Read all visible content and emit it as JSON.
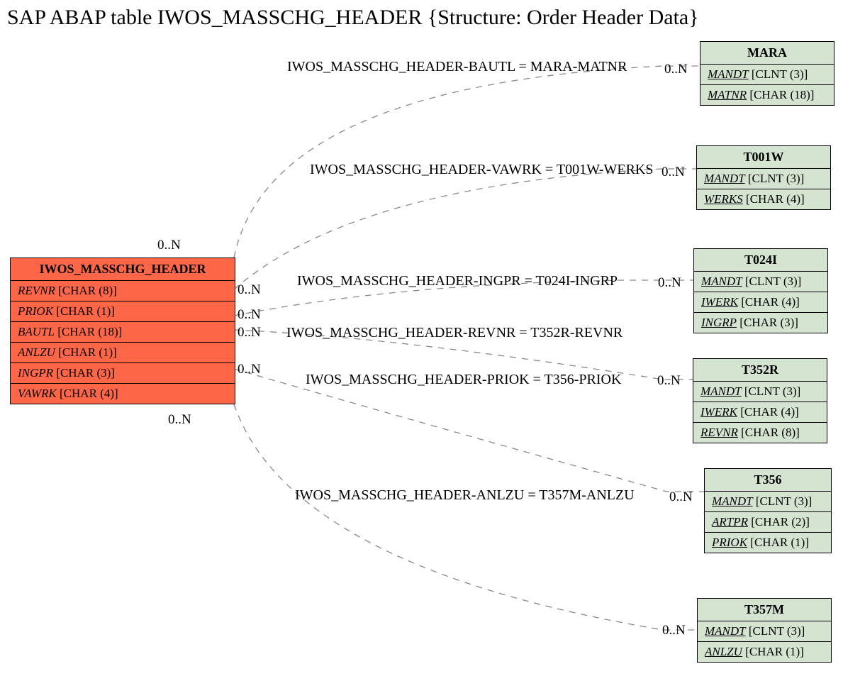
{
  "title": "SAP ABAP table IWOS_MASSCHG_HEADER {Structure: Order Header Data}",
  "mainTable": {
    "name": "IWOS_MASSCHG_HEADER",
    "fields": [
      {
        "name": "REVNR",
        "type": "[CHAR (8)]"
      },
      {
        "name": "PRIOK",
        "type": "[CHAR (1)]"
      },
      {
        "name": "BAUTL",
        "type": "[CHAR (18)]"
      },
      {
        "name": "ANLZU",
        "type": "[CHAR (1)]"
      },
      {
        "name": "INGPR",
        "type": "[CHAR (3)]"
      },
      {
        "name": "VAWRK",
        "type": "[CHAR (4)]"
      }
    ]
  },
  "relTables": [
    {
      "name": "MARA",
      "fields": [
        {
          "n": "MANDT",
          "t": "[CLNT (3)]",
          "pk": true
        },
        {
          "n": "MATNR",
          "t": "[CHAR (18)]",
          "pk": true
        }
      ]
    },
    {
      "name": "T001W",
      "fields": [
        {
          "n": "MANDT",
          "t": "[CLNT (3)]",
          "pk": true
        },
        {
          "n": "WERKS",
          "t": "[CHAR (4)]",
          "pk": true
        }
      ]
    },
    {
      "name": "T024I",
      "fields": [
        {
          "n": "MANDT",
          "t": "[CLNT (3)]",
          "pk": true
        },
        {
          "n": "IWERK",
          "t": "[CHAR (4)]",
          "pk": true
        },
        {
          "n": "INGRP",
          "t": "[CHAR (3)]",
          "pk": true
        }
      ]
    },
    {
      "name": "T352R",
      "fields": [
        {
          "n": "MANDT",
          "t": "[CLNT (3)]",
          "pk": true
        },
        {
          "n": "IWERK",
          "t": "[CHAR (4)]",
          "pk": true
        },
        {
          "n": "REVNR",
          "t": "[CHAR (8)]",
          "pk": true
        }
      ]
    },
    {
      "name": "T356",
      "fields": [
        {
          "n": "MANDT",
          "t": "[CLNT (3)]",
          "pk": true
        },
        {
          "n": "ARTPR",
          "t": "[CHAR (2)]",
          "pk": true
        },
        {
          "n": "PRIOK",
          "t": "[CHAR (1)]",
          "pk": true
        }
      ]
    },
    {
      "name": "T357M",
      "fields": [
        {
          "n": "MANDT",
          "t": "[CLNT (3)]",
          "pk": true
        },
        {
          "n": "ANLZU",
          "t": "[CHAR (1)]",
          "pk": true
        }
      ]
    }
  ],
  "edges": [
    {
      "label": "IWOS_MASSCHG_HEADER-BAUTL = MARA-MATNR"
    },
    {
      "label": "IWOS_MASSCHG_HEADER-VAWRK = T001W-WERKS"
    },
    {
      "label": "IWOS_MASSCHG_HEADER-INGPR = T024I-INGRP"
    },
    {
      "label": "IWOS_MASSCHG_HEADER-REVNR = T352R-REVNR"
    },
    {
      "label": "IWOS_MASSCHG_HEADER-PRIOK = T356-PRIOK"
    },
    {
      "label": "IWOS_MASSCHG_HEADER-ANLZU = T357M-ANLZU"
    }
  ],
  "card": "0..N"
}
